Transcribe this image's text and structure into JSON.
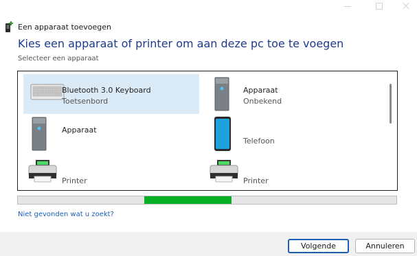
{
  "window": {
    "title": "Een apparaat toevoegen"
  },
  "heading": "Kies een apparaat of printer om aan deze pc toe te voegen",
  "subheading": "Selecteer een apparaat",
  "devices": [
    {
      "name": "Bluetooth 3.0 Keyboard",
      "type": "Toetsenbord",
      "icon": "keyboard-icon",
      "selected": true
    },
    {
      "name": "Apparaat",
      "type": "Onbekend",
      "icon": "computer-tower-icon",
      "selected": false
    },
    {
      "name": "Apparaat",
      "type": "",
      "icon": "computer-tower-icon",
      "selected": false
    },
    {
      "name": "",
      "type": "Telefoon",
      "icon": "phone-icon",
      "selected": false
    },
    {
      "name": "",
      "type": "Printer",
      "icon": "printer-icon",
      "selected": false
    },
    {
      "name": "",
      "type": "Printer",
      "icon": "printer-icon",
      "selected": false
    }
  ],
  "progress": {
    "color": "#06b025"
  },
  "help_link": "Niet gevonden wat u zoekt?",
  "buttons": {
    "next": "Volgende",
    "cancel": "Annuleren"
  },
  "colors": {
    "heading": "#1c3a8f",
    "selection": "#dbeaf7",
    "link": "#1a5fb4",
    "footer": "#f0f0f0"
  }
}
